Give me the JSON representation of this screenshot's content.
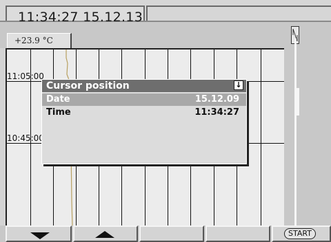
{
  "header": {
    "clock": "11:34:27  15.12.13"
  },
  "channel_tab": {
    "value": "+23.9  °C"
  },
  "chart": {
    "time_labels": [
      "11:05:00",
      "10:45:00"
    ],
    "trace_color": "#b8a060"
  },
  "popup": {
    "title": "Cursor position",
    "icon": "download-arrow-icon",
    "rows": [
      {
        "label": "Date",
        "value": "15.12.09"
      },
      {
        "label": "Time",
        "value": "11:34:27"
      }
    ]
  },
  "footer": {
    "buttons": [
      {
        "icon": "arrow-down-icon"
      },
      {
        "icon": "arrow-up-icon"
      },
      {
        "label": ""
      },
      {
        "label": ""
      },
      {
        "label": "START"
      }
    ]
  }
}
